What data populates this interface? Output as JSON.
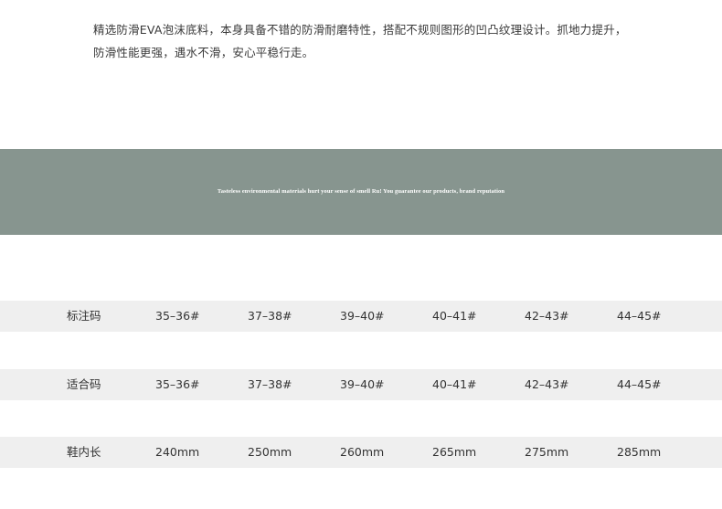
{
  "intro": {
    "line1": "精选防滑EVA泡沫底料，本身具备不错的防滑耐磨特性，搭配不规则图形的凹凸纹理设计。抓地力提升，",
    "line2": "防滑性能更强，遇水不滑，安心平稳行走。"
  },
  "banner": {
    "text": "Tasteless environmental materials hurt your sense of smell Ru! You guarantee our products, brand reputation",
    "color": "#87958f"
  },
  "size_table": {
    "rows": [
      {
        "label": "标注码",
        "values": [
          "35–36#",
          "37–38#",
          "39–40#",
          "40–41#",
          "42–43#",
          "44–45#"
        ]
      },
      {
        "label": "适合码",
        "values": [
          "35–36#",
          "37–38#",
          "39–40#",
          "40–41#",
          "42–43#",
          "44–45#"
        ]
      },
      {
        "label": "鞋内长",
        "values": [
          "240mm",
          "250mm",
          "260mm",
          "265mm",
          "275mm",
          "285mm"
        ]
      }
    ]
  }
}
